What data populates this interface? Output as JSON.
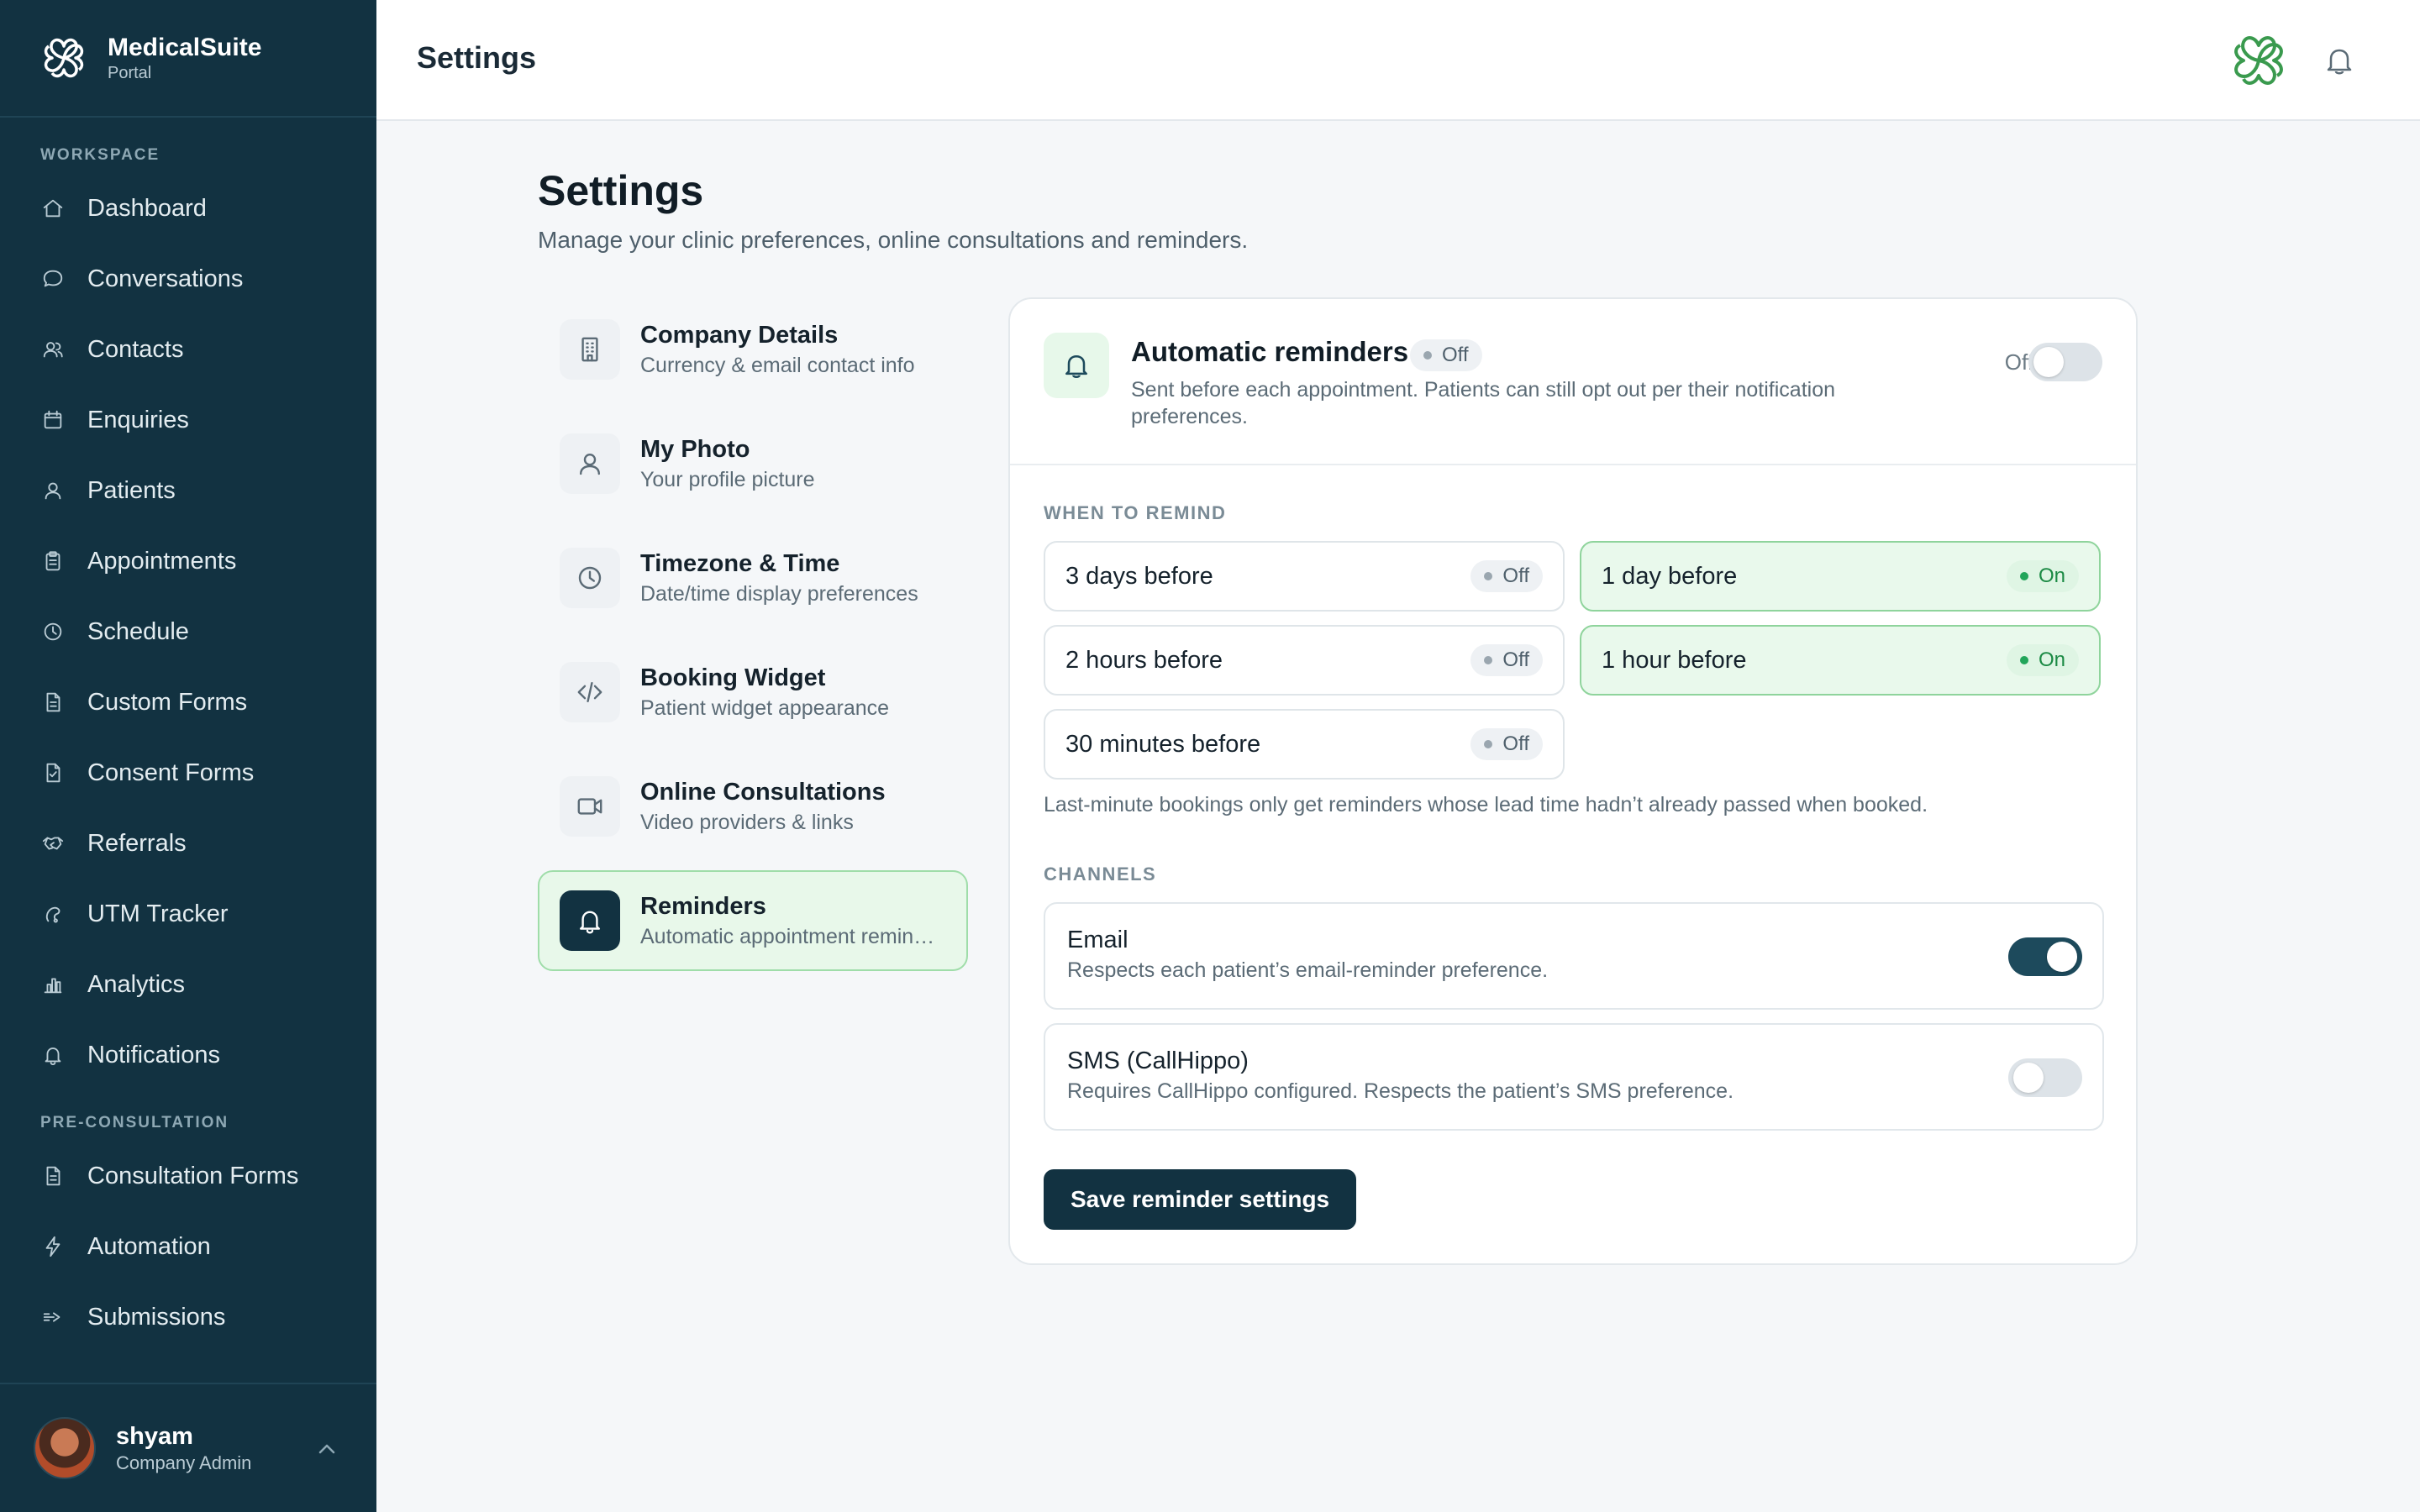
{
  "brand": {
    "name": "MedicalSuite",
    "subtitle": "Portal"
  },
  "sidebar": {
    "workspace_label": "WORKSPACE",
    "workspace_items": [
      {
        "label": "Dashboard",
        "icon": "home-icon"
      },
      {
        "label": "Conversations",
        "icon": "chat-icon"
      },
      {
        "label": "Contacts",
        "icon": "contacts-icon"
      },
      {
        "label": "Enquiries",
        "icon": "calendar-icon"
      },
      {
        "label": "Patients",
        "icon": "user-icon"
      },
      {
        "label": "Appointments",
        "icon": "clipboard-icon"
      },
      {
        "label": "Schedule",
        "icon": "clock-icon"
      },
      {
        "label": "Custom Forms",
        "icon": "document-icon"
      },
      {
        "label": "Consent Forms",
        "icon": "consent-document-icon"
      },
      {
        "label": "Referrals",
        "icon": "handshake-icon"
      },
      {
        "label": "UTM Tracker",
        "icon": "tracker-icon"
      },
      {
        "label": "Analytics",
        "icon": "bar-chart-icon"
      },
      {
        "label": "Notifications",
        "icon": "bell-icon"
      }
    ],
    "preconsult_label": "PRE-CONSULTATION",
    "preconsult_items": [
      {
        "label": "Consultation Forms",
        "icon": "document-icon"
      },
      {
        "label": "Automation",
        "icon": "lightning-icon"
      },
      {
        "label": "Submissions",
        "icon": "submit-icon"
      }
    ],
    "user": {
      "name": "shyam",
      "role": "Company Admin"
    }
  },
  "topbar": {
    "title": "Settings"
  },
  "main": {
    "title": "Settings",
    "subtitle": "Manage your clinic preferences, online consultations and reminders."
  },
  "settings_nav": [
    {
      "title": "Company Details",
      "desc": "Currency & email contact info",
      "icon": "building-icon",
      "active": false
    },
    {
      "title": "My Photo",
      "desc": "Your profile picture",
      "icon": "user-icon",
      "active": false
    },
    {
      "title": "Timezone & Time",
      "desc": "Date/time display preferences",
      "icon": "clock-icon",
      "active": false
    },
    {
      "title": "Booking Widget",
      "desc": "Patient widget appearance",
      "icon": "code-icon",
      "active": false
    },
    {
      "title": "Online Consultations",
      "desc": "Video providers & links",
      "icon": "video-icon",
      "active": false
    },
    {
      "title": "Reminders",
      "desc": "Automatic appointment reminders",
      "icon": "bell-icon",
      "active": true
    }
  ],
  "reminders": {
    "title": "Automatic reminders",
    "status": "Off",
    "description": "Sent before each appointment. Patients can still opt out per their notification preferences.",
    "toggle_label": "Off",
    "enabled": false,
    "when_label": "WHEN TO REMIND",
    "options": [
      {
        "label": "3 days before",
        "status": "Off",
        "on": false
      },
      {
        "label": "1 day before",
        "status": "On",
        "on": true
      },
      {
        "label": "2 hours before",
        "status": "Off",
        "on": false
      },
      {
        "label": "1 hour before",
        "status": "On",
        "on": true
      },
      {
        "label": "30 minutes before",
        "status": "Off",
        "on": false
      }
    ],
    "hint": "Last-minute bookings only get reminders whose lead time hadn’t already passed when booked.",
    "channels_label": "CHANNELS",
    "channels": [
      {
        "title": "Email",
        "desc": "Respects each patient’s email-reminder preference.",
        "on": true
      },
      {
        "title": "SMS (CallHippo)",
        "desc": "Requires CallHippo configured. Respects the patient’s SMS preference.",
        "on": false
      }
    ],
    "save_label": "Save reminder settings"
  },
  "colors": {
    "sidebar": "#123241",
    "accent_green": "#22a55a",
    "active_bg": "#e8f8ea"
  }
}
